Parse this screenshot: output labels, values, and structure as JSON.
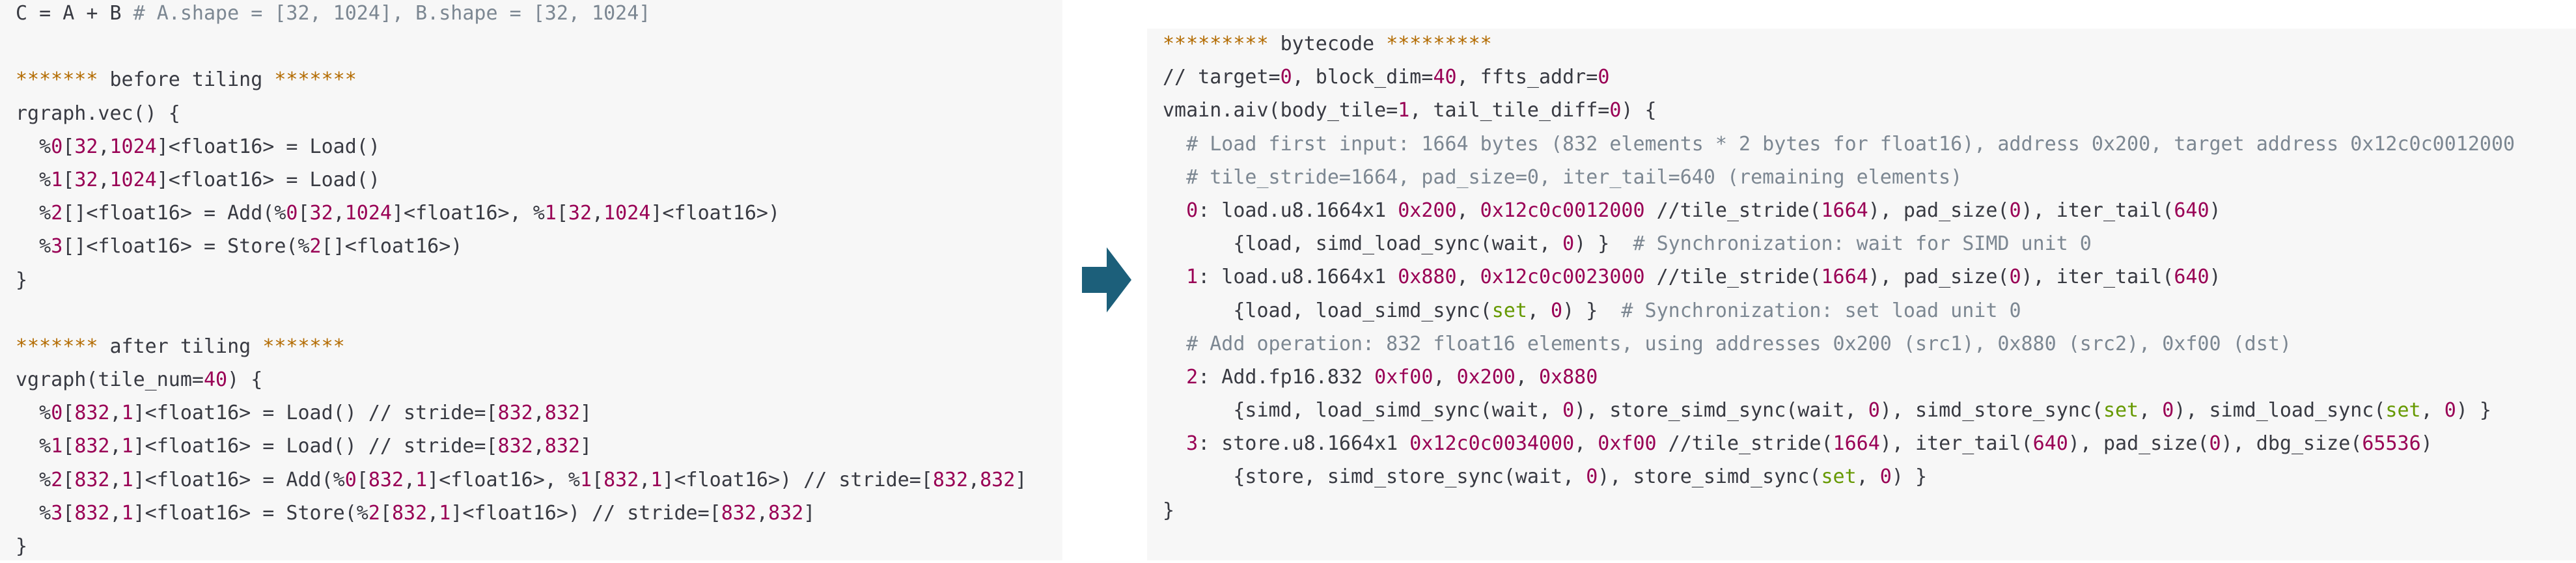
{
  "colors": {
    "panel_background": "#f7f7f7",
    "text": "#383a42",
    "comment": "#7c8792",
    "stars": "#b36b00",
    "number": "#990055",
    "keyword": "#669900",
    "arrow": "#1c5f7a"
  },
  "arrow_icon": "right-arrow-icon",
  "left_code": [
    [
      [
        "plain",
        "C = A + B "
      ],
      [
        "comment",
        "# A.shape = [32, 1024], B.shape = [32, 1024]"
      ]
    ],
    [],
    [
      [
        "star",
        "******* "
      ],
      [
        "plain",
        "before tiling "
      ],
      [
        "star",
        "*******"
      ]
    ],
    [
      [
        "plain",
        "rgraph.vec() {"
      ]
    ],
    [
      [
        "plain",
        "  %"
      ],
      [
        "num",
        "0"
      ],
      [
        "plain",
        "["
      ],
      [
        "num",
        "32"
      ],
      [
        "plain",
        ","
      ],
      [
        "num",
        "1024"
      ],
      [
        "plain",
        "]<float16> = Load()"
      ]
    ],
    [
      [
        "plain",
        "  %"
      ],
      [
        "num",
        "1"
      ],
      [
        "plain",
        "["
      ],
      [
        "num",
        "32"
      ],
      [
        "plain",
        ","
      ],
      [
        "num",
        "1024"
      ],
      [
        "plain",
        "]<float16> = Load()"
      ]
    ],
    [
      [
        "plain",
        "  %"
      ],
      [
        "num",
        "2"
      ],
      [
        "plain",
        "[]<float16> = Add(%"
      ],
      [
        "num",
        "0"
      ],
      [
        "plain",
        "["
      ],
      [
        "num",
        "32"
      ],
      [
        "plain",
        ","
      ],
      [
        "num",
        "1024"
      ],
      [
        "plain",
        "]<float16>, %"
      ],
      [
        "num",
        "1"
      ],
      [
        "plain",
        "["
      ],
      [
        "num",
        "32"
      ],
      [
        "plain",
        ","
      ],
      [
        "num",
        "1024"
      ],
      [
        "plain",
        "]<float16>)"
      ]
    ],
    [
      [
        "plain",
        "  %"
      ],
      [
        "num",
        "3"
      ],
      [
        "plain",
        "[]<float16> = Store(%"
      ],
      [
        "num",
        "2"
      ],
      [
        "plain",
        "[]<float16>)"
      ]
    ],
    [
      [
        "plain",
        "}"
      ]
    ],
    [],
    [
      [
        "star",
        "******* "
      ],
      [
        "plain",
        "after tiling "
      ],
      [
        "star",
        "*******"
      ]
    ],
    [
      [
        "plain",
        "vgraph(tile_num="
      ],
      [
        "num",
        "40"
      ],
      [
        "plain",
        ") {"
      ]
    ],
    [
      [
        "plain",
        "  %"
      ],
      [
        "num",
        "0"
      ],
      [
        "plain",
        "["
      ],
      [
        "num",
        "832"
      ],
      [
        "plain",
        ","
      ],
      [
        "num",
        "1"
      ],
      [
        "plain",
        "]<float16> = Load() // stride=["
      ],
      [
        "num",
        "832"
      ],
      [
        "plain",
        ","
      ],
      [
        "num",
        "832"
      ],
      [
        "plain",
        "]"
      ]
    ],
    [
      [
        "plain",
        "  %"
      ],
      [
        "num",
        "1"
      ],
      [
        "plain",
        "["
      ],
      [
        "num",
        "832"
      ],
      [
        "plain",
        ","
      ],
      [
        "num",
        "1"
      ],
      [
        "plain",
        "]<float16> = Load() // stride=["
      ],
      [
        "num",
        "832"
      ],
      [
        "plain",
        ","
      ],
      [
        "num",
        "832"
      ],
      [
        "plain",
        "]"
      ]
    ],
    [
      [
        "plain",
        "  %"
      ],
      [
        "num",
        "2"
      ],
      [
        "plain",
        "["
      ],
      [
        "num",
        "832"
      ],
      [
        "plain",
        ","
      ],
      [
        "num",
        "1"
      ],
      [
        "plain",
        "]<float16> = Add(%"
      ],
      [
        "num",
        "0"
      ],
      [
        "plain",
        "["
      ],
      [
        "num",
        "832"
      ],
      [
        "plain",
        ","
      ],
      [
        "num",
        "1"
      ],
      [
        "plain",
        "]<float16>, %"
      ],
      [
        "num",
        "1"
      ],
      [
        "plain",
        "["
      ],
      [
        "num",
        "832"
      ],
      [
        "plain",
        ","
      ],
      [
        "num",
        "1"
      ],
      [
        "plain",
        "]<float16>) // stride=["
      ],
      [
        "num",
        "832"
      ],
      [
        "plain",
        ","
      ],
      [
        "num",
        "832"
      ],
      [
        "plain",
        "]"
      ]
    ],
    [
      [
        "plain",
        "  %"
      ],
      [
        "num",
        "3"
      ],
      [
        "plain",
        "["
      ],
      [
        "num",
        "832"
      ],
      [
        "plain",
        ","
      ],
      [
        "num",
        "1"
      ],
      [
        "plain",
        "]<float16> = Store(%"
      ],
      [
        "num",
        "2"
      ],
      [
        "plain",
        "["
      ],
      [
        "num",
        "832"
      ],
      [
        "plain",
        ","
      ],
      [
        "num",
        "1"
      ],
      [
        "plain",
        "]<float16>) // stride=["
      ],
      [
        "num",
        "832"
      ],
      [
        "plain",
        ","
      ],
      [
        "num",
        "832"
      ],
      [
        "plain",
        "]"
      ]
    ],
    [
      [
        "plain",
        "}"
      ]
    ]
  ],
  "right_code": [
    [
      [
        "star",
        "********* "
      ],
      [
        "plain",
        "bytecode "
      ],
      [
        "star",
        "*********"
      ]
    ],
    [
      [
        "plain",
        "// target="
      ],
      [
        "num",
        "0"
      ],
      [
        "plain",
        ", block_dim="
      ],
      [
        "num",
        "40"
      ],
      [
        "plain",
        ", ffts_addr="
      ],
      [
        "num",
        "0"
      ]
    ],
    [
      [
        "plain",
        "vmain.aiv(body_tile="
      ],
      [
        "num",
        "1"
      ],
      [
        "plain",
        ", tail_tile_diff="
      ],
      [
        "num",
        "0"
      ],
      [
        "plain",
        ") {"
      ]
    ],
    [
      [
        "comment",
        "  # Load first input: 1664 bytes (832 elements * 2 bytes for float16), address 0x200, target address 0x12c0c0012000"
      ]
    ],
    [
      [
        "comment",
        "  # tile_stride=1664, pad_size=0, iter_tail=640 (remaining elements)"
      ]
    ],
    [
      [
        "plain",
        "  "
      ],
      [
        "num",
        "0"
      ],
      [
        "plain",
        ": load.u8.1664x1 "
      ],
      [
        "num",
        "0x200"
      ],
      [
        "plain",
        ", "
      ],
      [
        "num",
        "0x12c0c0012000"
      ],
      [
        "plain",
        " //tile_stride("
      ],
      [
        "num",
        "1664"
      ],
      [
        "plain",
        "), pad_size("
      ],
      [
        "num",
        "0"
      ],
      [
        "plain",
        "), iter_tail("
      ],
      [
        "num",
        "640"
      ],
      [
        "plain",
        ")"
      ]
    ],
    [
      [
        "plain",
        "      {load, simd_load_sync(wait, "
      ],
      [
        "num",
        "0"
      ],
      [
        "plain",
        ") }  "
      ],
      [
        "comment",
        "# Synchronization: wait for SIMD unit 0"
      ]
    ],
    [
      [
        "plain",
        "  "
      ],
      [
        "num",
        "1"
      ],
      [
        "plain",
        ": load.u8.1664x1 "
      ],
      [
        "num",
        "0x880"
      ],
      [
        "plain",
        ", "
      ],
      [
        "num",
        "0x12c0c0023000"
      ],
      [
        "plain",
        " //tile_stride("
      ],
      [
        "num",
        "1664"
      ],
      [
        "plain",
        "), pad_size("
      ],
      [
        "num",
        "0"
      ],
      [
        "plain",
        "), iter_tail("
      ],
      [
        "num",
        "640"
      ],
      [
        "plain",
        ")"
      ]
    ],
    [
      [
        "plain",
        "      {load, load_simd_sync("
      ],
      [
        "kw",
        "set"
      ],
      [
        "plain",
        ", "
      ],
      [
        "num",
        "0"
      ],
      [
        "plain",
        ") }  "
      ],
      [
        "comment",
        "# Synchronization: set load unit 0"
      ]
    ],
    [
      [
        "comment",
        "  # Add operation: 832 float16 elements, using addresses 0x200 (src1), 0x880 (src2), 0xf00 (dst)"
      ]
    ],
    [
      [
        "plain",
        "  "
      ],
      [
        "num",
        "2"
      ],
      [
        "plain",
        ": Add.fp16.832 "
      ],
      [
        "num",
        "0xf00"
      ],
      [
        "plain",
        ", "
      ],
      [
        "num",
        "0x200"
      ],
      [
        "plain",
        ", "
      ],
      [
        "num",
        "0x880"
      ]
    ],
    [
      [
        "plain",
        "      {simd, load_simd_sync(wait, "
      ],
      [
        "num",
        "0"
      ],
      [
        "plain",
        "), store_simd_sync(wait, "
      ],
      [
        "num",
        "0"
      ],
      [
        "plain",
        "), simd_store_sync("
      ],
      [
        "kw",
        "set"
      ],
      [
        "plain",
        ", "
      ],
      [
        "num",
        "0"
      ],
      [
        "plain",
        "), simd_load_sync("
      ],
      [
        "kw",
        "set"
      ],
      [
        "plain",
        ", "
      ],
      [
        "num",
        "0"
      ],
      [
        "plain",
        ") }"
      ]
    ],
    [
      [
        "plain",
        "  "
      ],
      [
        "num",
        "3"
      ],
      [
        "plain",
        ": store.u8.1664x1 "
      ],
      [
        "num",
        "0x12c0c0034000"
      ],
      [
        "plain",
        ", "
      ],
      [
        "num",
        "0xf00"
      ],
      [
        "plain",
        " //tile_stride("
      ],
      [
        "num",
        "1664"
      ],
      [
        "plain",
        "), iter_tail("
      ],
      [
        "num",
        "640"
      ],
      [
        "plain",
        "), pad_size("
      ],
      [
        "num",
        "0"
      ],
      [
        "plain",
        "), dbg_size("
      ],
      [
        "num",
        "65536"
      ],
      [
        "plain",
        ")"
      ]
    ],
    [
      [
        "plain",
        "      {store, simd_store_sync(wait, "
      ],
      [
        "num",
        "0"
      ],
      [
        "plain",
        "), store_simd_sync("
      ],
      [
        "kw",
        "set"
      ],
      [
        "plain",
        ", "
      ],
      [
        "num",
        "0"
      ],
      [
        "plain",
        ") }"
      ]
    ],
    [
      [
        "plain",
        "}"
      ]
    ]
  ]
}
